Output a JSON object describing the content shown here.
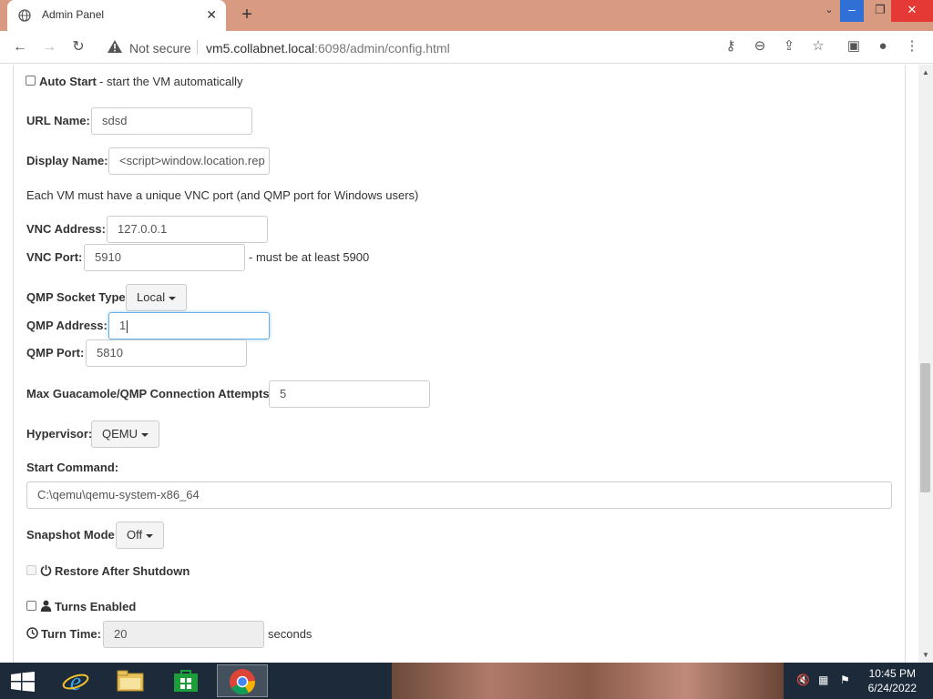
{
  "browser": {
    "tab_title": "Admin Panel",
    "tab_close": "✕",
    "new_tab": "+",
    "not_secure": "Not secure",
    "url_host": "vm5.collabnet.local",
    "url_path": ":6098/admin/config.html",
    "win_min": "–",
    "win_restore": "❐",
    "win_close": "✕"
  },
  "form": {
    "auto_start_label": "Auto Start",
    "auto_start_desc": "- start the VM automatically",
    "url_name_label": "URL Name:",
    "url_name_value": "sdsd",
    "display_name_label": "Display Name:",
    "display_name_value": "<script>window.location.rep",
    "vnc_note": "Each VM must have a unique VNC port (and QMP port for Windows users)",
    "vnc_address_label": "VNC Address:",
    "vnc_address_value": "127.0.0.1",
    "vnc_port_label": "VNC Port:",
    "vnc_port_value": "5910",
    "vnc_port_hint": "- must be at least 5900",
    "qmp_socket_type_label": "QMP Socket Type:",
    "qmp_socket_type_value": "Local",
    "qmp_address_label": "QMP Address:",
    "qmp_address_value": "1",
    "qmp_port_label": "QMP Port:",
    "qmp_port_value": "5810",
    "max_attempts_label": "Max Guacamole/QMP Connection Attempts:",
    "max_attempts_value": "5",
    "hypervisor_label": "Hypervisor:",
    "hypervisor_value": "QEMU",
    "start_command_label": "Start Command:",
    "start_command_value": "C:\\qemu\\qemu-system-x86_64",
    "snapshot_mode_label": "Snapshot Mode:",
    "snapshot_mode_value": "Off",
    "restore_label": "Restore After Shutdown",
    "turns_label": "Turns Enabled",
    "turn_time_label": "Turn Time:",
    "turn_time_value": "20",
    "turn_time_unit": "seconds"
  },
  "taskbar": {
    "time": "10:45 PM",
    "date": "6/24/2022"
  },
  "colors": {
    "tab_bar": "#d99a82",
    "focus_border": "#66afe9",
    "close_button": "#e53935"
  }
}
